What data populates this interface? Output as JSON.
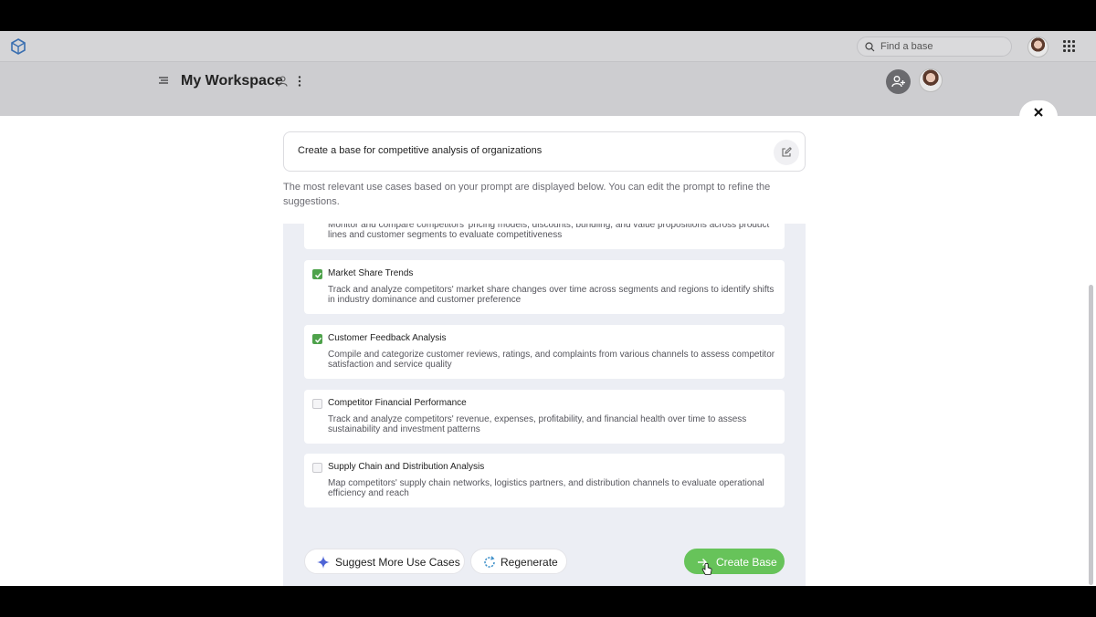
{
  "header": {
    "search_placeholder": "Find a base"
  },
  "workspace": {
    "title": "My Workspace"
  },
  "modal": {
    "prompt": "Create a base for competitive analysis of organizations",
    "helper_text": "The most relevant use cases based on your prompt are displayed below. You can edit the prompt to refine the suggestions.",
    "use_cases": [
      {
        "title": "",
        "description": "Monitor and compare competitors' pricing models, discounts, bundling, and value propositions across product lines and customer segments to evaluate competitiveness",
        "checked": true
      },
      {
        "title": "Market Share Trends",
        "description": "Track and analyze competitors' market share changes over time across segments and regions to identify shifts in industry dominance and customer preference",
        "checked": true
      },
      {
        "title": "Customer Feedback Analysis",
        "description": "Compile and categorize customer reviews, ratings, and complaints from various channels to assess competitor satisfaction and service quality",
        "checked": true
      },
      {
        "title": "Competitor Financial Performance",
        "description": "Track and analyze competitors' revenue, expenses, profitability, and financial health over time to assess sustainability and investment patterns",
        "checked": false
      },
      {
        "title": "Supply Chain and Distribution Analysis",
        "description": "Map competitors' supply chain networks, logistics partners, and distribution channels to evaluate operational efficiency and reach",
        "checked": false
      }
    ],
    "actions": {
      "suggest_more": "Suggest More Use Cases",
      "regenerate": "Regenerate",
      "create_base": "Create Base"
    }
  },
  "colors": {
    "accent_green": "#67c35a",
    "checkbox_green": "#4ea24b",
    "panel_bg": "#eceef4"
  }
}
